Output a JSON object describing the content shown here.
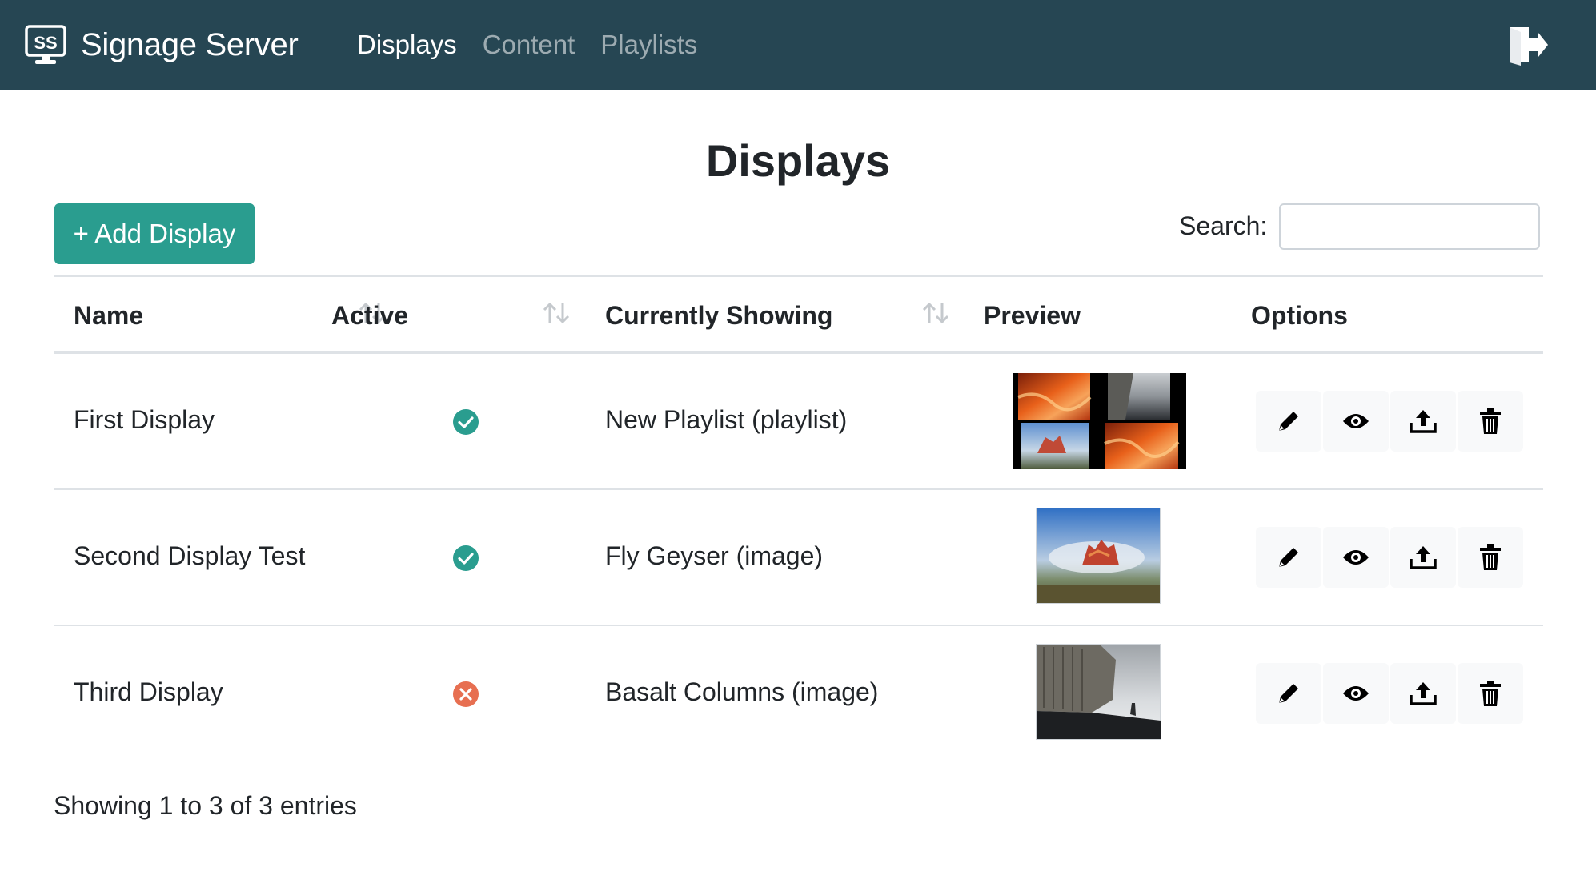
{
  "app": {
    "brand_name": "Signage Server",
    "logo_text": "SS",
    "nav": [
      {
        "label": "Displays",
        "active": true
      },
      {
        "label": "Content",
        "active": false
      },
      {
        "label": "Playlists",
        "active": false
      }
    ],
    "logout_icon": "logout-icon",
    "colors": {
      "navbar": "#264653",
      "accent": "#2a9d8f",
      "active": "#2a9d8f",
      "inactive": "#e76f51"
    }
  },
  "page": {
    "title": "Displays",
    "add_button_label": "+ Add Display",
    "search_label": "Search:",
    "search_value": "",
    "search_placeholder": ""
  },
  "table": {
    "columns": [
      {
        "label": "Name",
        "sortable": true
      },
      {
        "label": "Active",
        "sortable": true
      },
      {
        "label": "Currently Showing",
        "sortable": true
      },
      {
        "label": "Preview",
        "sortable": false
      },
      {
        "label": "Options",
        "sortable": false
      }
    ],
    "rows": [
      {
        "name": "First Display",
        "active": true,
        "status_icon": "check-circle-icon",
        "showing": "New Playlist (playlist)",
        "preview": "playlist-collage-thumbnail"
      },
      {
        "name": "Second Display Test",
        "active": true,
        "status_icon": "check-circle-icon",
        "showing": "Fly Geyser (image)",
        "preview": "fly-geyser-thumbnail"
      },
      {
        "name": "Third Display",
        "active": false,
        "status_icon": "x-circle-icon",
        "showing": "Basalt Columns (image)",
        "preview": "basalt-columns-thumbnail"
      }
    ],
    "row_options": [
      "pencil-icon",
      "eye-icon",
      "upload-icon",
      "trash-icon"
    ],
    "info": "Showing 1 to 3 of 3 entries"
  }
}
